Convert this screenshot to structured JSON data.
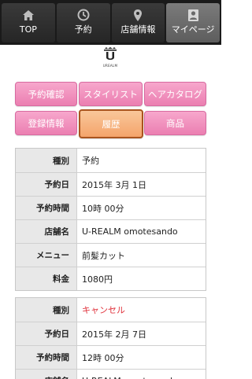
{
  "nav": [
    {
      "label": "TOP",
      "icon": "home-icon"
    },
    {
      "label": "予約",
      "icon": "clock-icon"
    },
    {
      "label": "店舗情報",
      "icon": "map-pin-icon"
    },
    {
      "label": "マイページ",
      "icon": "mypage-icon",
      "active": true
    }
  ],
  "logo": {
    "mark": "U",
    "text": "UREALM"
  },
  "menu": {
    "reservation_check": "予約確認",
    "stylist": "スタイリスト",
    "hair_catalog": "ヘアカタログ",
    "registration_info": "登録情報",
    "history": "履歴",
    "products": "商品"
  },
  "records": [
    {
      "rows": [
        {
          "label": "種別",
          "value": "予約"
        },
        {
          "label": "予約日",
          "value": "2015年 3月 1日"
        },
        {
          "label": "予約時間",
          "value": "10時 00分"
        },
        {
          "label": "店舗名",
          "value": "U-REALM omotesando"
        },
        {
          "label": "メニュー",
          "value": "前髪カット"
        },
        {
          "label": "料金",
          "value": "1080円"
        }
      ]
    },
    {
      "rows": [
        {
          "label": "種別",
          "value": "キャンセル"
        },
        {
          "label": "予約日",
          "value": "2015年 2月 7日"
        },
        {
          "label": "予約時間",
          "value": "12時 00分"
        },
        {
          "label": "店舗名",
          "value": "U-REALM omotesando"
        }
      ]
    }
  ],
  "colors": {
    "accent_pink": "#eb7fb1",
    "active_orange": "#f4a46b",
    "cancel_red": "#e0303a"
  }
}
